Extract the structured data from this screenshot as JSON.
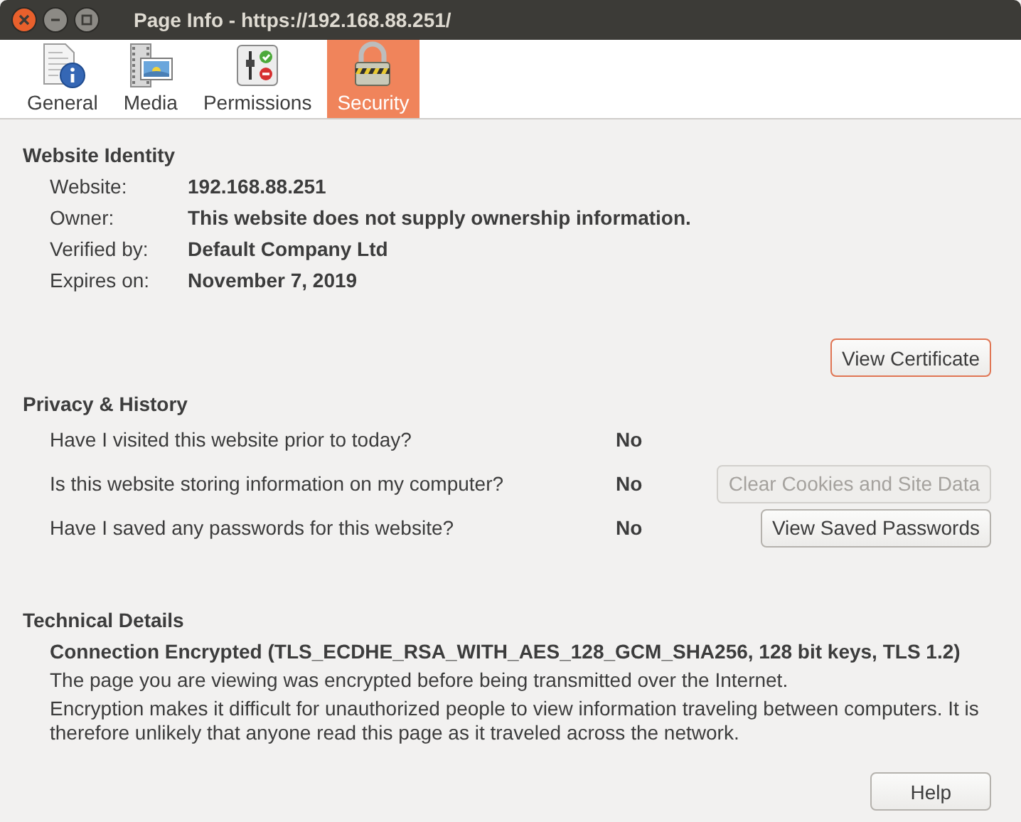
{
  "window": {
    "title": "Page Info - https://192.168.88.251/"
  },
  "tabs": [
    {
      "label": "General",
      "kind": "general",
      "selected": false
    },
    {
      "label": "Media",
      "kind": "media",
      "selected": false
    },
    {
      "label": "Permissions",
      "kind": "permissions",
      "selected": false
    },
    {
      "label": "Security",
      "kind": "security",
      "selected": true
    }
  ],
  "website_identity": {
    "heading": "Website Identity",
    "fields": [
      {
        "label": "Website:",
        "value": "192.168.88.251"
      },
      {
        "label": "Owner:",
        "value": "This website does not supply ownership information."
      },
      {
        "label": "Verified by:",
        "value": "Default Company Ltd"
      },
      {
        "label": "Expires on:",
        "value": "November 7, 2019"
      }
    ],
    "button": {
      "label": "View Certificate",
      "focused": true,
      "disabled": false
    }
  },
  "privacy_history": {
    "heading": "Privacy & History",
    "rows": [
      {
        "question": "Have I visited this website prior to today?",
        "answer": "No"
      },
      {
        "question": "Is this website storing information on my computer?",
        "answer": "No",
        "button": {
          "label": "Clear Cookies and Site Data",
          "focused": false,
          "disabled": true
        }
      },
      {
        "question": "Have I saved any passwords for this website?",
        "answer": "No",
        "button": {
          "label": "View Saved Passwords",
          "focused": false,
          "disabled": false
        }
      }
    ]
  },
  "technical_details": {
    "heading": "Technical Details",
    "connection": "Connection Encrypted (TLS_ECDHE_RSA_WITH_AES_128_GCM_SHA256, 128 bit keys, TLS 1.2)",
    "paragraphs": [
      "The page you are viewing was encrypted before being transmitted over the Internet.",
      "Encryption makes it difficult for unauthorized people to view information traveling between computers. It is therefore unlikely that anyone read this page as it traveled across the network."
    ]
  },
  "help_button": {
    "label": "Help"
  }
}
